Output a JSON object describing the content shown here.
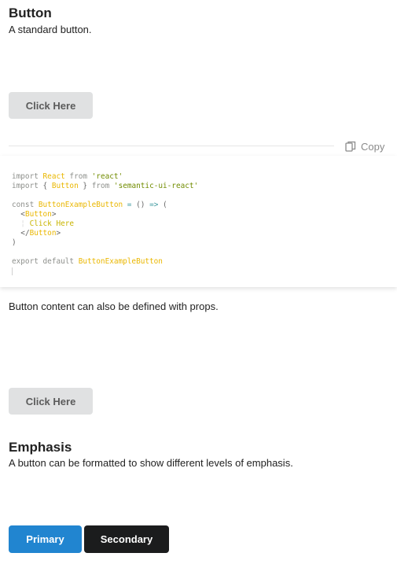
{
  "button_section": {
    "title": "Button",
    "description": "A standard button.",
    "button_label": "Click Here"
  },
  "code_toolbar": {
    "copy_label": "Copy",
    "copy_icon": "copy-icon"
  },
  "code_lines": [
    "import React from 'react'",
    "import { Button } from 'semantic-ui-react'",
    "",
    "const ButtonExampleButton = () => (",
    "  <Button>",
    "    Click Here",
    "  </Button>",
    ")",
    "",
    "export default ButtonExampleButton"
  ],
  "props_section": {
    "description": "Button content can also be defined with props.",
    "button_label": "Click Here"
  },
  "emphasis_section": {
    "title": "Emphasis",
    "description": "A button can be formatted to show different levels of emphasis.",
    "primary_label": "Primary",
    "secondary_label": "Secondary"
  },
  "colors": {
    "primary": "#2185d0",
    "secondary": "#1b1c1d",
    "default_button": "#e0e1e2"
  }
}
